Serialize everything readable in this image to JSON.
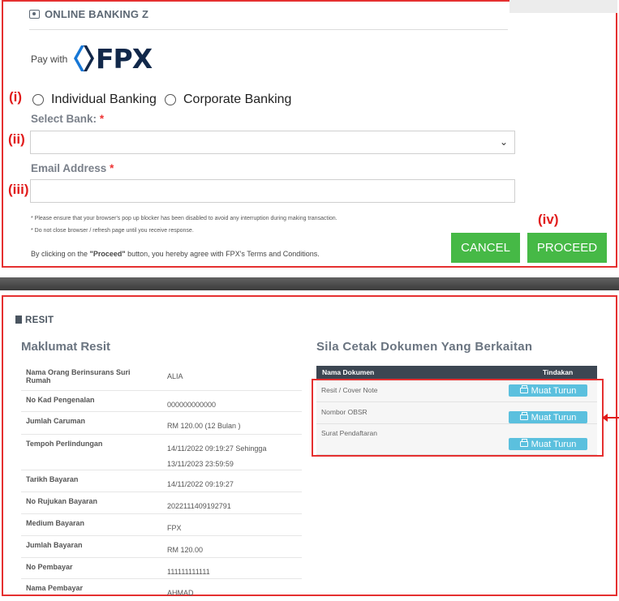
{
  "payment_form": {
    "title": "ONLINE BANKING Z",
    "pay_with": "Pay with",
    "logo_text": "FPX",
    "markers": [
      "(i)",
      "(ii)",
      "(iii)",
      "(iv)"
    ],
    "banking_options": [
      "Individual Banking",
      "Corporate Banking"
    ],
    "select_bank_label": "Select Bank:",
    "email_label": "Email Address",
    "required_mark": "*",
    "notes": [
      "* Please ensure that your browser's pop up blocker has been disabled to avoid any interruption during making transaction.",
      "* Do not close browser / refresh page until you receive response."
    ],
    "agreement_prefix": "By clicking on the ",
    "agreement_bold": "\"Proceed\"",
    "agreement_suffix": " button, you hereby agree with FPX's Terms and Conditions.",
    "cancel_label": "CANCEL",
    "proceed_label": "PROCEED",
    "button_color": "#46b946"
  },
  "receipt": {
    "title": "RESIT",
    "details_heading": "Maklumat Resit",
    "rows": [
      {
        "label": "Nama Orang Berinsurans Suri Rumah",
        "value": "ALIA"
      },
      {
        "label": "No Kad Pengenalan",
        "value": "000000000000"
      },
      {
        "label": "Jumlah Caruman",
        "value": "RM 120.00 (12 Bulan )"
      },
      {
        "label": "Tempoh Perlindungan",
        "value": "14/11/2022 09:19:27 Sehingga 13/11/2023 23:59:59"
      },
      {
        "label": "Tarikh Bayaran",
        "value": "14/11/2022 09:19:27"
      },
      {
        "label": "No Rujukan Bayaran",
        "value": "2022111409192791"
      },
      {
        "label": "Medium Bayaran",
        "value": "FPX"
      },
      {
        "label": "Jumlah Bayaran",
        "value": "RM 120.00"
      },
      {
        "label": "No Pembayar",
        "value": "111111111111"
      },
      {
        "label": "Nama Pembayar",
        "value": "AHMAD"
      }
    ],
    "documents_heading": "Sila Cetak Dokumen Yang Berkaitan",
    "doc_table_headers": [
      "Nama Dokumen",
      "Tindakan"
    ],
    "documents": [
      "Resit / Cover Note",
      "Nombor OBSR",
      "Surat Pendaftaran"
    ],
    "download_label": "Muat Turun",
    "download_color": "#5bc0de",
    "highlight_color": "#e53030"
  }
}
